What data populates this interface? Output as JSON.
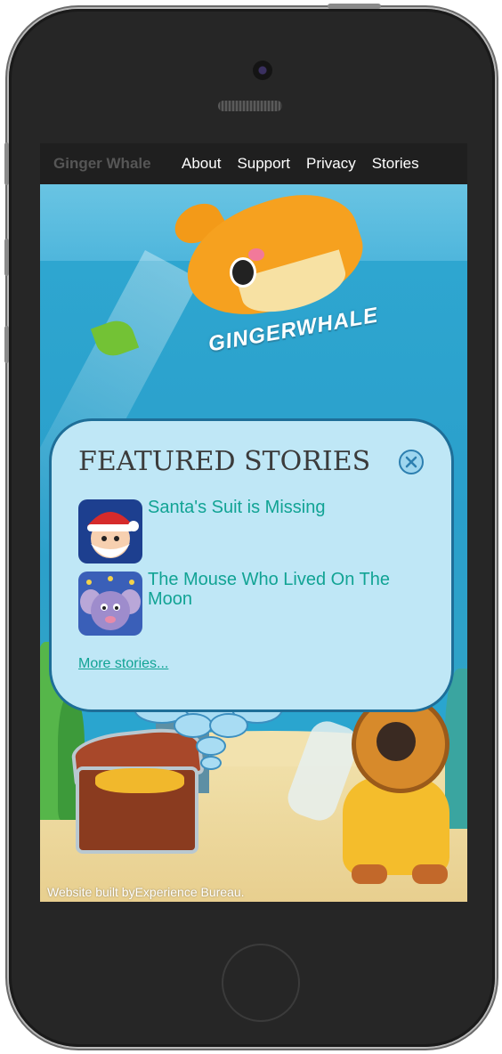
{
  "nav": {
    "brand": "Ginger Whale",
    "links": [
      "About",
      "Support",
      "Privacy",
      "Stories"
    ]
  },
  "hero": {
    "logo_text": "GINGERWHALE"
  },
  "featured": {
    "title": "FEATURED STORIES",
    "stories": [
      {
        "title": "Santa's Suit is Missing"
      },
      {
        "title": "The Mouse Who Lived On The Moon"
      }
    ],
    "more_link": "More stories..."
  },
  "footer": {
    "credit": "Website built byExperience Bureau."
  },
  "colors": {
    "accent_link": "#11a394",
    "panel_bg": "#bfe7f6",
    "panel_border": "#1e6e98",
    "nav_bg": "#1f1f1f"
  },
  "icons": {
    "close": "close-circle-icon"
  }
}
